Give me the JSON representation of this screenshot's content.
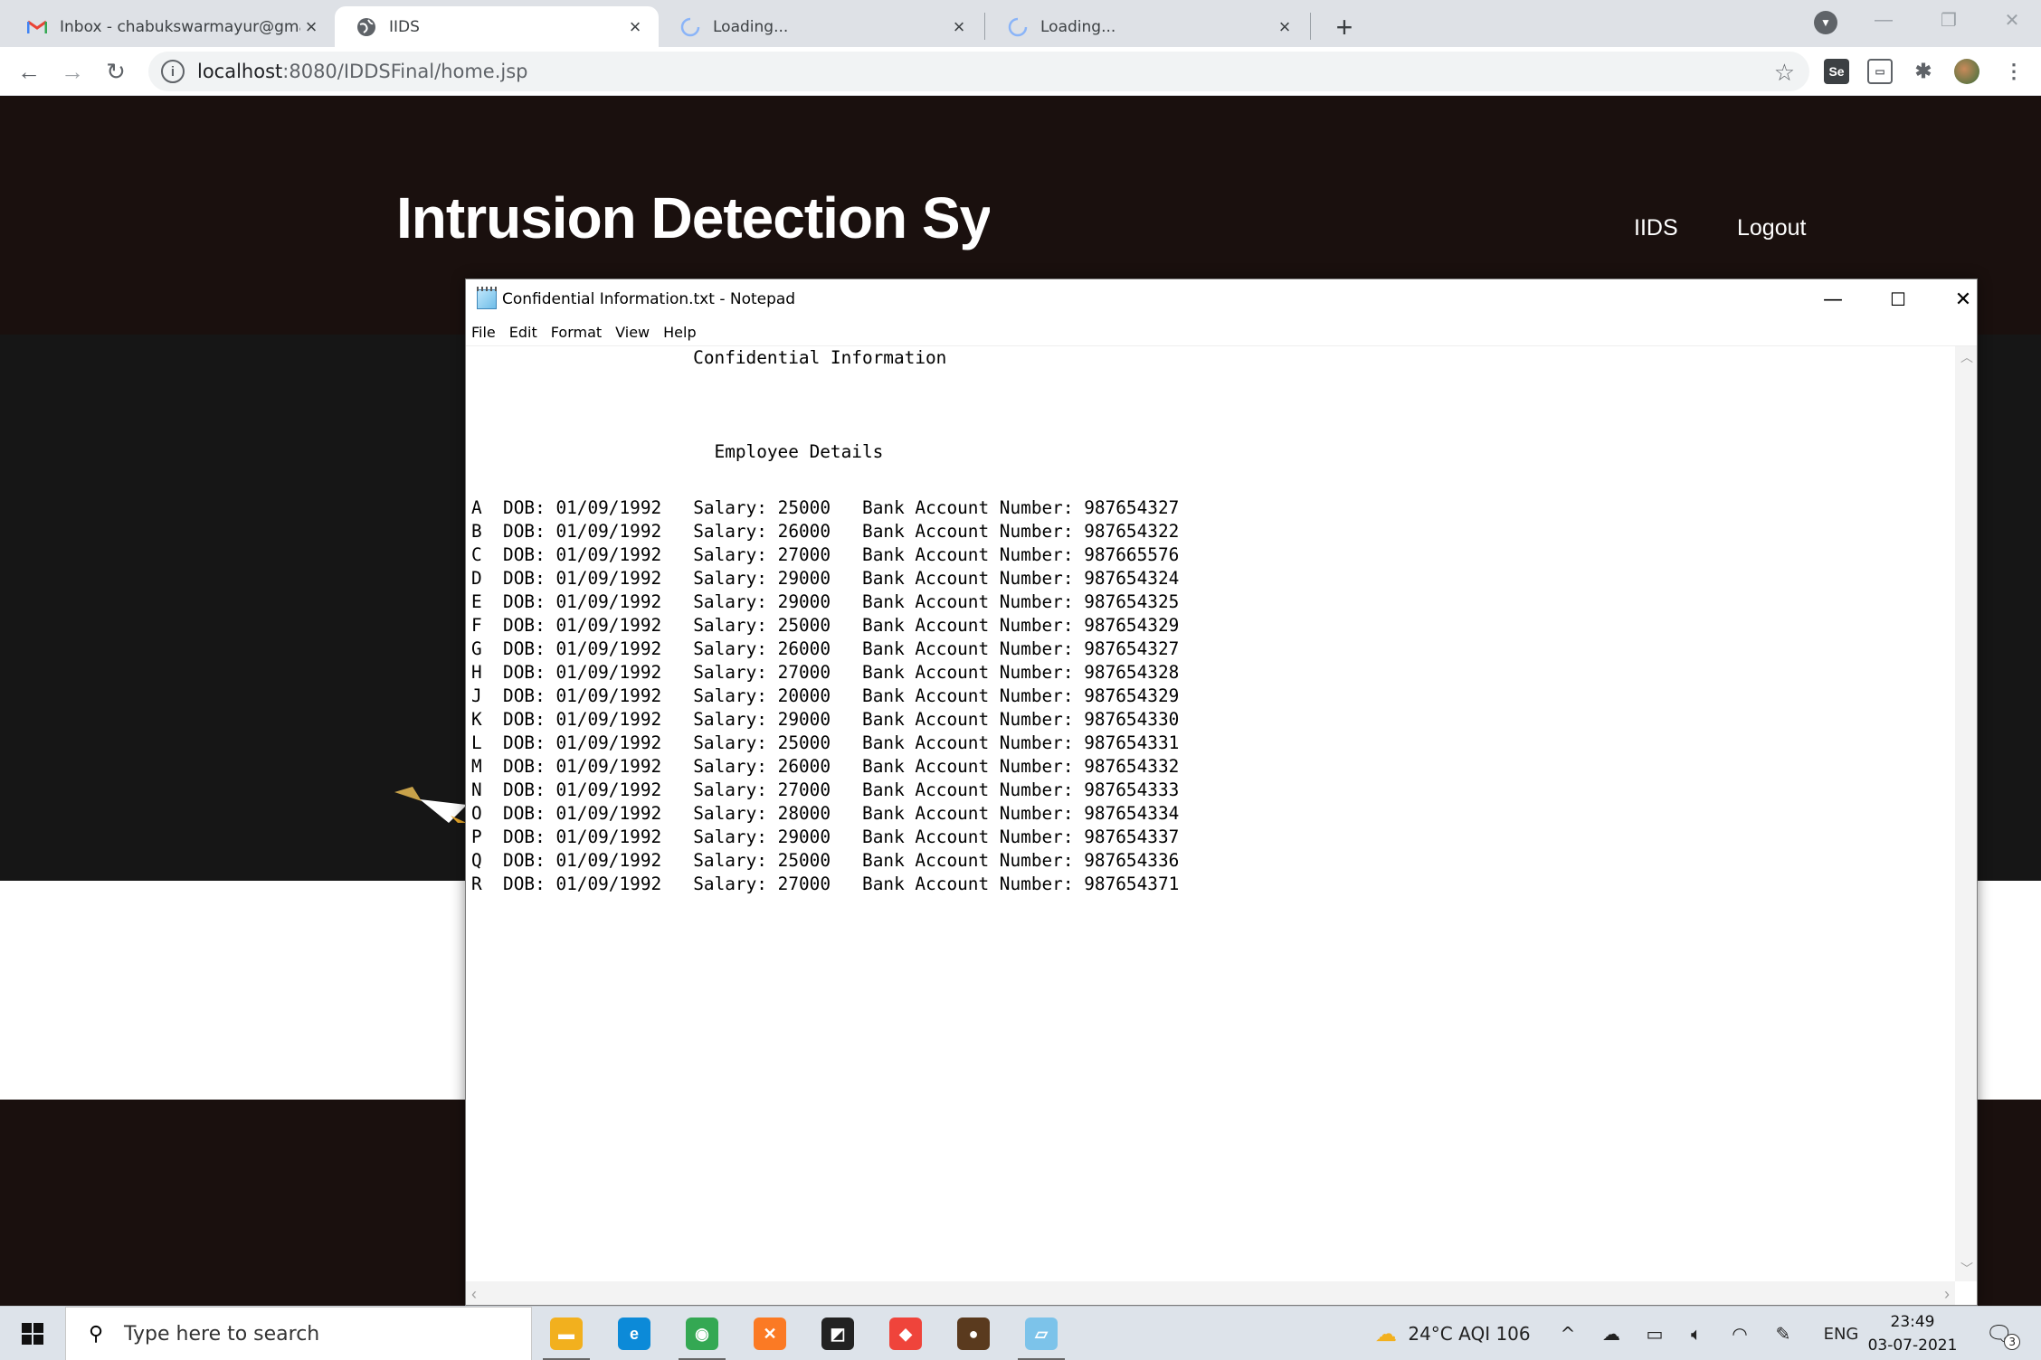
{
  "browser": {
    "tabs": [
      {
        "label": "Inbox - chabukswarmayur@gmail.com",
        "favicon": "gmail-icon",
        "active": false
      },
      {
        "label": "IIDS",
        "favicon": "globe-icon",
        "active": true
      },
      {
        "label": "Loading...",
        "favicon": "loading-spinner-icon",
        "active": false
      },
      {
        "label": "Loading...",
        "favicon": "loading-spinner-icon",
        "active": false
      }
    ],
    "new_tab": "+",
    "url_host": "localhost",
    "url_rest": ":8080/IDDSFinal/home.jsp",
    "extension_label": "Se"
  },
  "site": {
    "title": "Intrusion Detection System",
    "nav": [
      "IIDS",
      "Logout"
    ]
  },
  "notepad": {
    "window_title": "Confidential Information.txt - Notepad",
    "menu": [
      "File",
      "Edit",
      "Format",
      "View",
      "Help"
    ],
    "heading": "Confidential Information",
    "subheading": "Employee Details",
    "rows": [
      {
        "id": "A",
        "dob": "01/09/1992",
        "salary": "25000",
        "account": "987654327"
      },
      {
        "id": "B",
        "dob": "01/09/1992",
        "salary": "26000",
        "account": "987654322"
      },
      {
        "id": "C",
        "dob": "01/09/1992",
        "salary": "27000",
        "account": "987665576"
      },
      {
        "id": "D",
        "dob": "01/09/1992",
        "salary": "29000",
        "account": "987654324"
      },
      {
        "id": "E",
        "dob": "01/09/1992",
        "salary": "29000",
        "account": "987654325"
      },
      {
        "id": "F",
        "dob": "01/09/1992",
        "salary": "25000",
        "account": "987654329"
      },
      {
        "id": "G",
        "dob": "01/09/1992",
        "salary": "26000",
        "account": "987654327"
      },
      {
        "id": "H",
        "dob": "01/09/1992",
        "salary": "27000",
        "account": "987654328"
      },
      {
        "id": "J",
        "dob": "01/09/1992",
        "salary": "20000",
        "account": "987654329"
      },
      {
        "id": "K",
        "dob": "01/09/1992",
        "salary": "29000",
        "account": "987654330"
      },
      {
        "id": "L",
        "dob": "01/09/1992",
        "salary": "25000",
        "account": "987654331"
      },
      {
        "id": "M",
        "dob": "01/09/1992",
        "salary": "26000",
        "account": "987654332"
      },
      {
        "id": "N",
        "dob": "01/09/1992",
        "salary": "27000",
        "account": "987654333"
      },
      {
        "id": "O",
        "dob": "01/09/1992",
        "salary": "28000",
        "account": "987654334"
      },
      {
        "id": "P",
        "dob": "01/09/1992",
        "salary": "29000",
        "account": "987654337"
      },
      {
        "id": "Q",
        "dob": "01/09/1992",
        "salary": "25000",
        "account": "987654336"
      },
      {
        "id": "R",
        "dob": "01/09/1992",
        "salary": "27000",
        "account": "987654371"
      }
    ],
    "labels": {
      "dob": "DOB:",
      "salary": "Salary:",
      "account": "Bank Account Number:"
    }
  },
  "taskbar": {
    "search_placeholder": "Type here to search",
    "apps": [
      {
        "name": "file-explorer-icon",
        "color": "#f2b01e"
      },
      {
        "name": "edge-icon",
        "color": "#0c8ad8"
      },
      {
        "name": "chrome-icon",
        "color": "#34a853"
      },
      {
        "name": "xampp-icon",
        "color": "#fb7a24"
      },
      {
        "name": "sticky-notes-icon",
        "color": "#222222"
      },
      {
        "name": "anydesk-icon",
        "color": "#ef443b"
      },
      {
        "name": "app-icon",
        "color": "#5a3a1e"
      },
      {
        "name": "notepad-icon",
        "color": "#7cc3ea"
      }
    ],
    "weather": "24°C  AQI 106",
    "language": "ENG",
    "time": "23:49",
    "date": "03-07-2021",
    "notification_count": "3"
  },
  "colors": {
    "header_bg": "#1a100e",
    "hero_bg": "#161616",
    "tab_strip": "#dee1e6"
  }
}
